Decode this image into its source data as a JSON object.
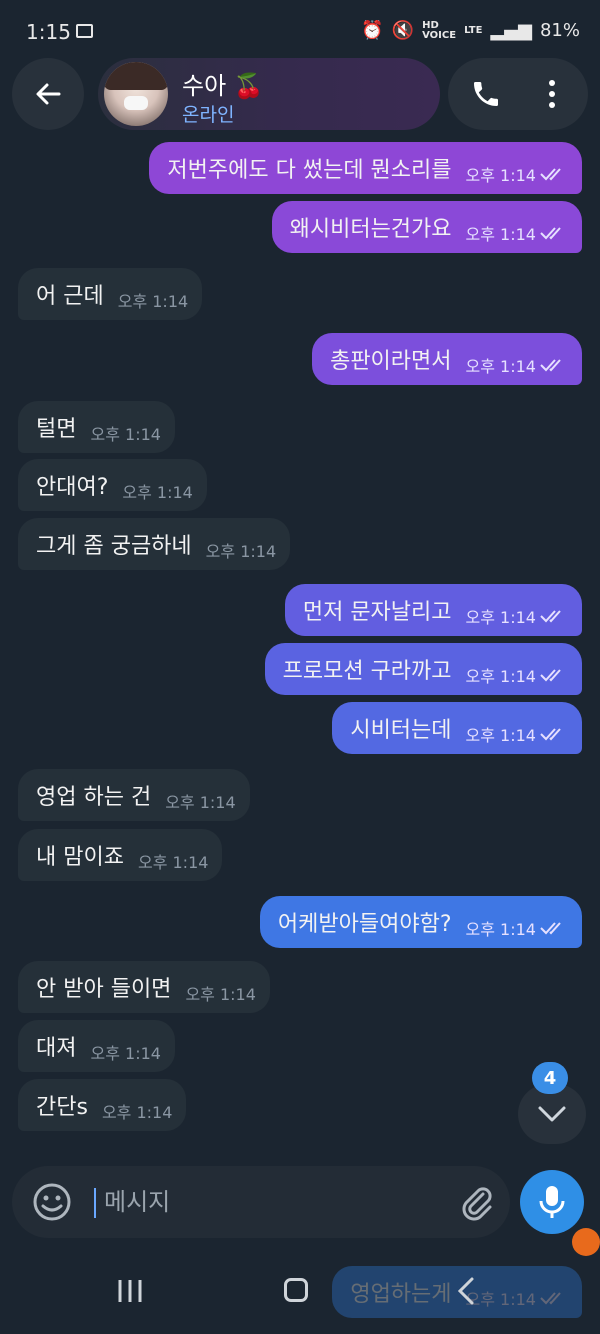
{
  "status_bar": {
    "time": "1:15",
    "hd_label": "HD\nVOICE",
    "lte_label": "LTE",
    "battery": "81%"
  },
  "header": {
    "contact_name": "수아 🍒",
    "contact_status": "온라인"
  },
  "messages": [
    {
      "dir": "out",
      "text": "저번주에도 다 썼는데 뭔소리를",
      "time": "오후 1:14",
      "color": "#8e47d6"
    },
    {
      "dir": "out",
      "text": "왜시비터는건가요",
      "time": "오후 1:14",
      "color": "#8a49d8"
    },
    {
      "dir": "in",
      "text": "어 근데",
      "time": "오후 1:14"
    },
    {
      "dir": "out",
      "text": "총판이라면서",
      "time": "오후 1:14",
      "color": "#7c4fdc"
    },
    {
      "dir": "in",
      "text": "털면",
      "time": "오후 1:14"
    },
    {
      "dir": "in",
      "text": "안대여?",
      "time": "오후 1:14"
    },
    {
      "dir": "in",
      "text": "그게 좀 궁금하네",
      "time": "오후 1:14"
    },
    {
      "dir": "out",
      "text": "먼저 문자날리고",
      "time": "오후 1:14",
      "color": "#625ee0"
    },
    {
      "dir": "out",
      "text": "프로모션 구라까고",
      "time": "오후 1:14",
      "color": "#5a63e1"
    },
    {
      "dir": "out",
      "text": "시비터는데",
      "time": "오후 1:14",
      "color": "#5369e2"
    },
    {
      "dir": "in",
      "text": "영업 하는 건",
      "time": "오후 1:14"
    },
    {
      "dir": "in",
      "text": "내 맘이죠",
      "time": "오후 1:14"
    },
    {
      "dir": "out",
      "text": "어케받아들여야함?",
      "time": "오후 1:14",
      "color": "#3f77e4"
    },
    {
      "dir": "in",
      "text": "안 받아 들이면",
      "time": "오후 1:14"
    },
    {
      "dir": "in",
      "text": "대져",
      "time": "오후 1:14"
    },
    {
      "dir": "in",
      "text": "간단s",
      "time": "오후 1:14"
    },
    {
      "dir": "out",
      "text": "영업하는게",
      "time": "오후 1:14",
      "color": "#2f80e6"
    }
  ],
  "unread_count": "4",
  "composer": {
    "placeholder": "메시지"
  }
}
